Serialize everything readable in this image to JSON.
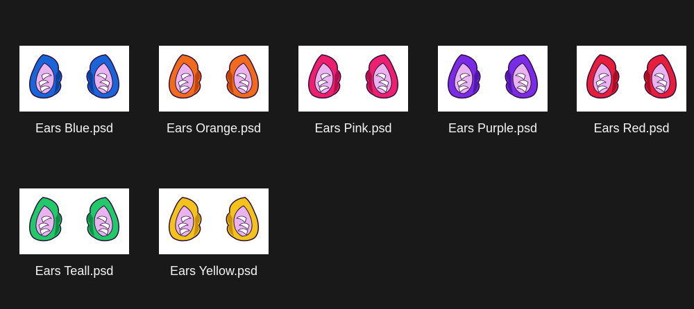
{
  "files": [
    {
      "name": "Ears Blue.psd",
      "icon": "ears-thumbnail-icon",
      "color": "#1a63d8",
      "shade": "#0d3f9c"
    },
    {
      "name": "Ears Orange.psd",
      "icon": "ears-thumbnail-icon",
      "color": "#f26a1b",
      "shade": "#c0440a"
    },
    {
      "name": "Ears Pink.psd",
      "icon": "ears-thumbnail-icon",
      "color": "#ee1f6f",
      "shade": "#b30e4c"
    },
    {
      "name": "Ears Purple.psd",
      "icon": "ears-thumbnail-icon",
      "color": "#7a2be6",
      "shade": "#5216ad"
    },
    {
      "name": "Ears Red.psd",
      "icon": "ears-thumbnail-icon",
      "color": "#e61e3c",
      "shade": "#a80d24"
    },
    {
      "name": "Ears Teall.psd",
      "icon": "ears-thumbnail-icon",
      "color": "#22c96a",
      "shade": "#0f8f45"
    },
    {
      "name": "Ears Yellow.psd",
      "icon": "ears-thumbnail-icon",
      "color": "#f3c21b",
      "shade": "#c6900b"
    }
  ],
  "colors": {
    "background": "#191919",
    "label_text": "#f2f2f2",
    "inner_ear": "#e9b3ef",
    "inner_ear_tuft": "#ffffff",
    "outline": "#2a0f3a"
  }
}
